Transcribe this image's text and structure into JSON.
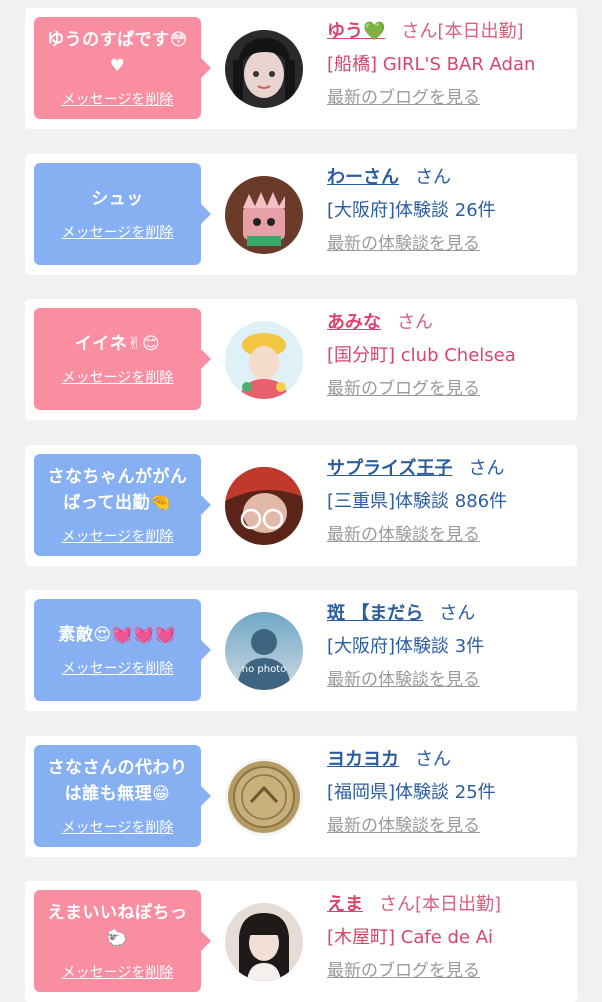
{
  "items": [
    {
      "type": "pink",
      "message": "ゆうのすぱです😳\n♥",
      "delete_label": "メッセージを削除",
      "user_name": "ゆう💚",
      "honorific": "さん",
      "badge": "[本日出勤]",
      "detail": "[船橋] GIRL'S BAR Adan",
      "link": "最新のブログを見る",
      "avatar_icon": "avatar-photo-icon"
    },
    {
      "type": "blue",
      "message": "シュッ",
      "delete_label": "メッセージを削除",
      "user_name": "わーさん",
      "honorific": "さん",
      "badge": "",
      "detail": "[大阪府]体験談 26件",
      "link": "最新の体験談を見る",
      "avatar_icon": "avatar-photo-icon"
    },
    {
      "type": "pink",
      "message": "イイネ✌😊",
      "delete_label": "メッセージを削除",
      "user_name": "あみな",
      "honorific": "さん",
      "badge": "",
      "detail": "[国分町] club Chelsea",
      "link": "最新のブログを見る",
      "avatar_icon": "avatar-photo-icon"
    },
    {
      "type": "blue",
      "message": "さなちゃんががん\nばって出勤🤏",
      "delete_label": "メッセージを削除",
      "user_name": "サプライズ王子",
      "honorific": "さん",
      "badge": "",
      "detail": "[三重県]体験談 886件",
      "link": "最新の体験談を見る",
      "avatar_icon": "avatar-photo-icon"
    },
    {
      "type": "blue",
      "message": "素敵😍💓💓💓",
      "delete_label": "メッセージを削除",
      "user_name": "斑 【まだら",
      "honorific": "さん",
      "badge": "",
      "detail": "[大阪府]体験談 3件",
      "link": "最新の体験談を見る",
      "avatar_icon": "no-photo-icon",
      "avatar_text": "no photo"
    },
    {
      "type": "blue",
      "message": "さなさんの代わり\nは誰も無理😁",
      "delete_label": "メッセージを削除",
      "user_name": "ヨカヨカ",
      "honorific": "さん",
      "badge": "",
      "detail": "[福岡県]体験談 25件",
      "link": "最新の体験談を見る",
      "avatar_icon": "coin-icon"
    },
    {
      "type": "pink",
      "message": "えまいいねぽちっ\n🐑",
      "delete_label": "メッセージを削除",
      "user_name": "えま",
      "honorific": "さん",
      "badge": "[本日出勤]",
      "detail": "[木屋町] Cafe de Ai",
      "link": "最新のブログを見る",
      "avatar_icon": "avatar-photo-icon"
    }
  ]
}
